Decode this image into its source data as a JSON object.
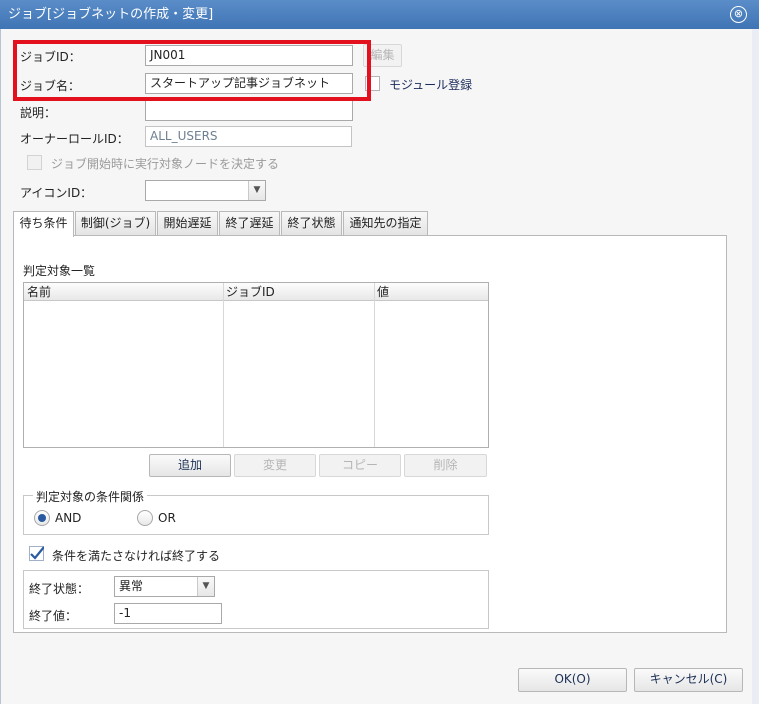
{
  "dialog": {
    "title": "ジョブ[ジョブネットの作成・変更]",
    "close_glyph": "⊗"
  },
  "form": {
    "job_id_label": "ジョブID：",
    "job_id_value": "JN001",
    "edit_button": "編集",
    "job_name_label": "ジョブ名：",
    "job_name_value": "スタートアップ記事ジョブネット",
    "module_register_label": "モジュール登録",
    "description_label": "説明：",
    "description_value": "",
    "owner_role_label": "オーナーロールID：",
    "owner_role_value": "ALL_USERS",
    "decide_node_label": "ジョブ開始時に実行対象ノードを決定する",
    "icon_id_label": "アイコンID：",
    "icon_id_value": ""
  },
  "tabs": [
    {
      "label": "待ち条件",
      "active": true
    },
    {
      "label": "制御(ジョブ)",
      "active": false
    },
    {
      "label": "開始遅延",
      "active": false
    },
    {
      "label": "終了遅延",
      "active": false
    },
    {
      "label": "終了状態",
      "active": false
    },
    {
      "label": "通知先の指定",
      "active": false
    }
  ],
  "wait_condition": {
    "list_title": "判定対象一覧",
    "columns": [
      "名前",
      "ジョブID",
      "値"
    ],
    "rows": [],
    "buttons": {
      "add": "追加",
      "modify": "変更",
      "copy": "コピー",
      "delete": "削除"
    },
    "relation_legend": "判定対象の条件関係",
    "relation_options": [
      "AND",
      "OR"
    ],
    "relation_selected": "AND",
    "end_if_unmet_label": "条件を満たさなければ終了する",
    "end_if_unmet_checked": true,
    "end_status_label": "終了状態：",
    "end_status_value": "異常",
    "end_value_label": "終了値：",
    "end_value_value": "-1"
  },
  "footer": {
    "ok_button": "OK(O)",
    "cancel_button": "キャンセル(C)"
  },
  "colors": {
    "titlebar": "#4a80c0",
    "highlight_border": "#e3101e",
    "checkmark": "#2a5aa0"
  }
}
